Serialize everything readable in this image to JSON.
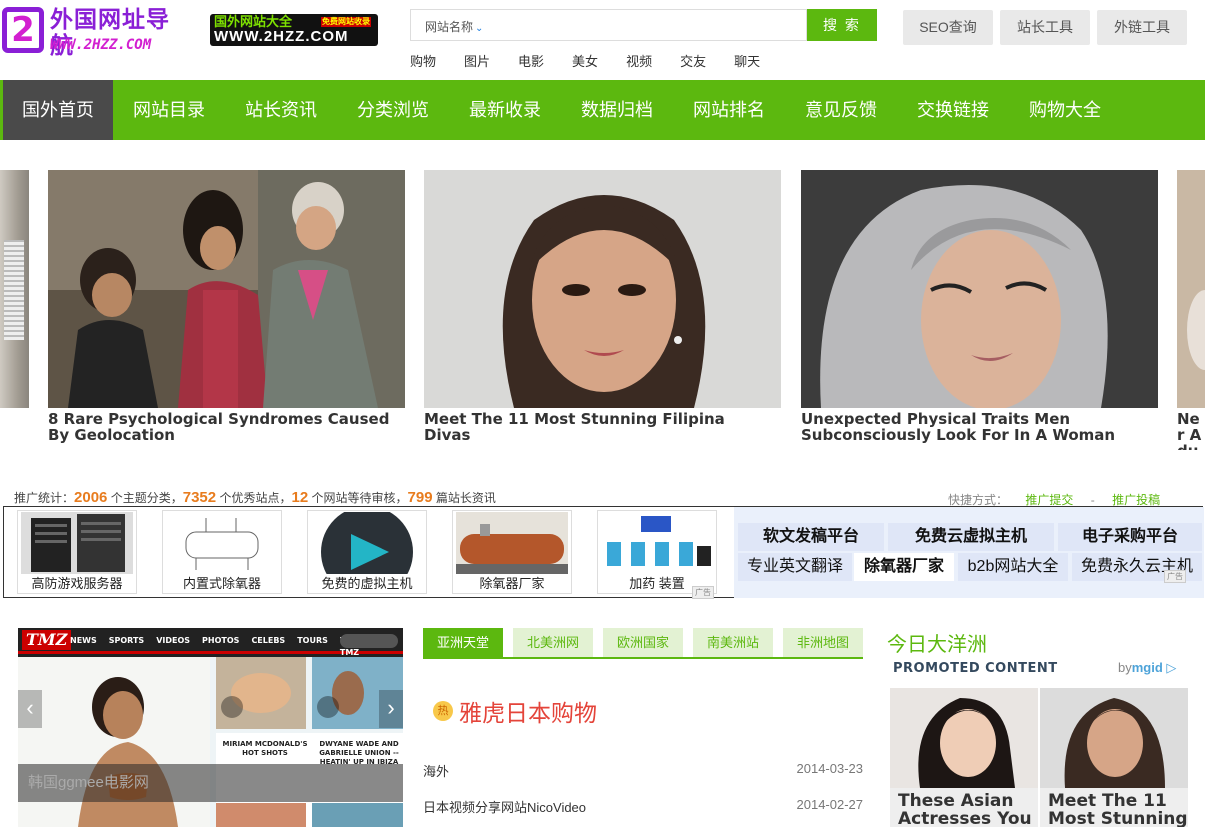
{
  "header": {
    "logo_primary_text": "外国网址导航",
    "logo_primary_domain": "WWW.2HZZ.COM",
    "logo_primary_mark": "2",
    "logo_secondary_title": "国外网站大全",
    "logo_secondary_badge": "免费网站收录",
    "logo_secondary_domain": "WWW.2HZZ.COM",
    "search_category": "网站名称",
    "search_value": "",
    "search_button": "搜 索",
    "quick_links": [
      "购物",
      "图片",
      "电影",
      "美女",
      "视频",
      "交友",
      "聊天"
    ],
    "tools": [
      "SEO查询",
      "站长工具",
      "外链工具"
    ]
  },
  "nav": {
    "items": [
      "国外首页",
      "网站目录",
      "站长资讯",
      "分类浏览",
      "最新收录",
      "数据归档",
      "网站排名",
      "意见反馈",
      "交换链接",
      "购物大全"
    ],
    "active_index": 0
  },
  "featured": [
    {
      "caption": "8 Rare Psychological Syndromes Caused By Geolocation"
    },
    {
      "caption": "Meet The 11 Most Stunning Filipina Divas"
    },
    {
      "caption": "Unexpected Physical Traits Men Subconsciously Look For In A Woman"
    },
    {
      "caption": "Ner Adu"
    }
  ],
  "stats": {
    "prefix": "推广统计：",
    "categories": "2006",
    "categories_label": "个主题分类，",
    "sites": "7352",
    "sites_label": "个优秀站点，",
    "pending": "12",
    "pending_label": "个网站等待审核，",
    "articles": "799",
    "articles_label": "篇站长资讯"
  },
  "shortcuts": {
    "label": "快捷方式：",
    "links": [
      "推广提交",
      "推广投稿"
    ],
    "separator": "-"
  },
  "ads": {
    "image_ads": [
      "高防游戏服务器",
      "内置式除氧器",
      "免费的虚拟主机",
      "除氧器厂家",
      "加药 装置"
    ],
    "text_ads_row1": [
      "软文发稿平台",
      "免费云虚拟主机",
      "电子采购平台"
    ],
    "text_ads_row2": [
      "专业英文翻译",
      "除氧器厂家",
      "b2b网站大全",
      "免费永久云主机"
    ],
    "ad_marker": "广告"
  },
  "slider": {
    "brand": "TMZ",
    "nav": [
      "NEWS",
      "SPORTS",
      "VIDEOS",
      "PHOTOS",
      "CELEBS",
      "TOURS",
      "WATCH TMZ"
    ],
    "thumb1_caption": "MIRIAM MCDONALD'S HOT SHOTS",
    "thumb2_caption": "DWYANE WADE AND GABRIELLE UNION -- HEATIN' UP IN IBIZA",
    "caption": "韩国ggmee电影网"
  },
  "region_tabs": {
    "items": [
      "亚洲天堂",
      "北美洲网",
      "欧洲国家",
      "南美洲站",
      "非洲地图"
    ],
    "active_index": 0,
    "hot_badge": "热",
    "hot_title": "雅虎日本购物",
    "rows": [
      {
        "title": "海外",
        "date": "2014-03-23"
      },
      {
        "title": "日本视频分享网站NicoVideo",
        "date": "2014-02-27"
      }
    ]
  },
  "oceania": {
    "title": "今日大洋洲",
    "promoted": "PROMOTED CONTENT",
    "mgid_prefix": "by",
    "mgid_brand": "mgid",
    "cards": [
      {
        "caption": "These Asian Actresses You"
      },
      {
        "caption": "Meet The 11 Most Stunning"
      }
    ]
  },
  "colors": {
    "accent_green": "#5cb80f",
    "nav_active": "#4a4a4a",
    "stat_orange": "#e87c1e",
    "hot_red": "#e4443a"
  }
}
